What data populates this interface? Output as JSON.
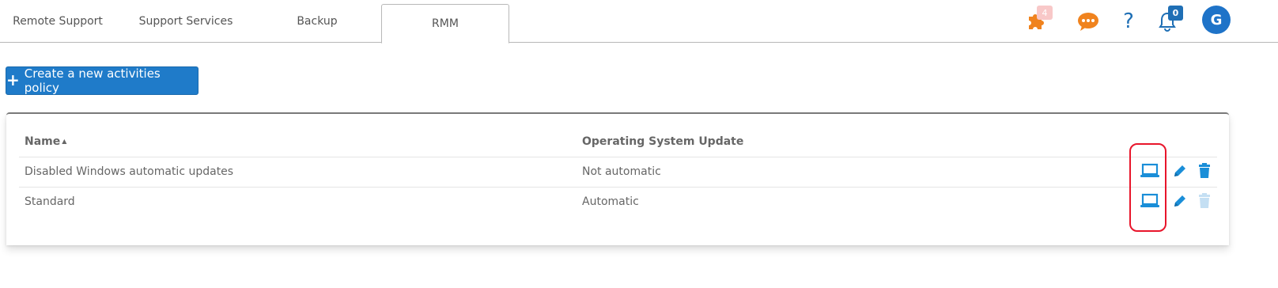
{
  "tabs": [
    {
      "label": "Remote Support"
    },
    {
      "label": "Support Services"
    },
    {
      "label": "Backup"
    },
    {
      "label": "RMM",
      "active": true
    }
  ],
  "header": {
    "extensions_badge": "4",
    "notifications_badge": "0",
    "avatar_initial": "G",
    "icons": [
      "puzzle-icon",
      "chat-icon",
      "help-icon",
      "bell-icon"
    ]
  },
  "create_button": {
    "label": "Create a new activities policy"
  },
  "table": {
    "columns": [
      "Name",
      "Operating System Update"
    ],
    "sort_column": "Name",
    "rows": [
      {
        "name": "Disabled Windows automatic updates",
        "os_update": "Not automatic",
        "delete_enabled": true
      },
      {
        "name": "Standard",
        "os_update": "Automatic",
        "delete_enabled": false
      }
    ]
  },
  "colors": {
    "accent": "#1f7bc9",
    "orange": "#f0831e",
    "icon_blue": "#1a8ed8",
    "highlight": "#e8152b"
  }
}
